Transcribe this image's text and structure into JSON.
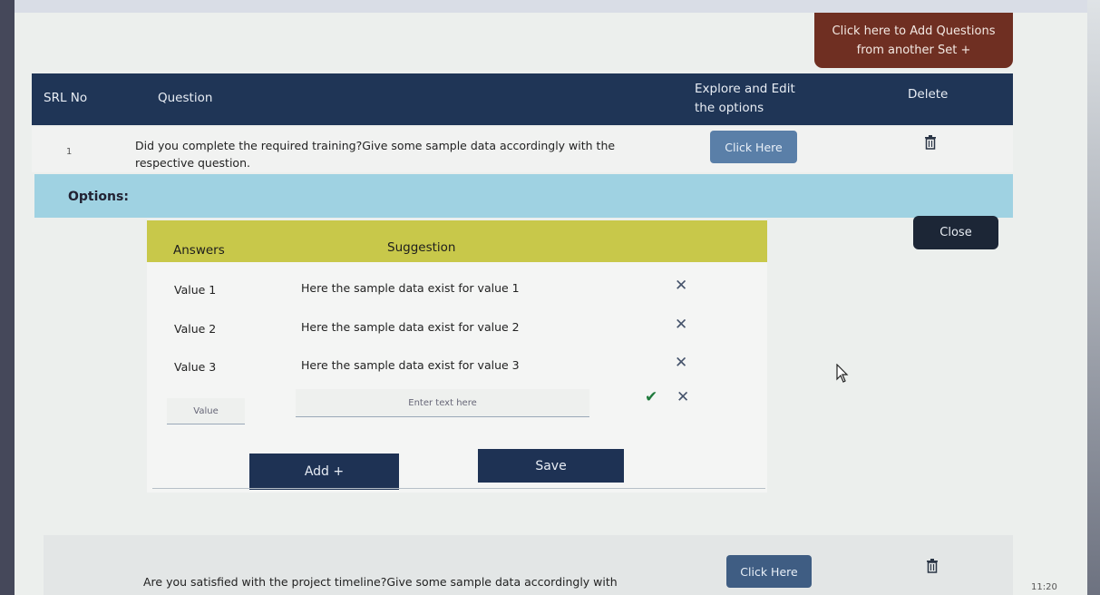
{
  "top_action": {
    "line1": "Click here to Add Questions",
    "line2": "from another Set +"
  },
  "table_header": {
    "srl": "SRL No",
    "question": "Question",
    "explore_line1": "Explore and Edit",
    "explore_line2": "the options",
    "delete": "Delete"
  },
  "rows": [
    {
      "srl": "1",
      "question": "Did you complete the required training?Give some sample data accordingly with the respective question.",
      "action": "Click Here"
    },
    {
      "question": "Are you satisfied with the project timeline?Give some sample data accordingly with",
      "action": "Click Here"
    }
  ],
  "options": {
    "title": "Options:",
    "close_label": "Close",
    "headers": {
      "answers": "Answers",
      "suggestion": "Suggestion"
    },
    "items": [
      {
        "value": "Value 1",
        "suggestion": "Here the sample data exist for value 1"
      },
      {
        "value": "Value 2",
        "suggestion": "Here the sample data exist for value 2"
      },
      {
        "value": "Value 3",
        "suggestion": "Here the sample data exist for value 3"
      }
    ],
    "new_value_placeholder": "Value",
    "new_suggestion_placeholder": "Enter text here",
    "add_label": "Add +",
    "save_label": "Save"
  },
  "icons": {
    "remove": "close-icon",
    "confirm": "check-icon",
    "delete": "trash-icon"
  },
  "colors": {
    "header_navy": "#1f3556",
    "options_bar": "#9fd2e2",
    "answers_header": "#c8c84a",
    "top_action_brown": "#6f2f22",
    "click_here_blue": "#5a7fa8"
  },
  "clock": "11:20"
}
